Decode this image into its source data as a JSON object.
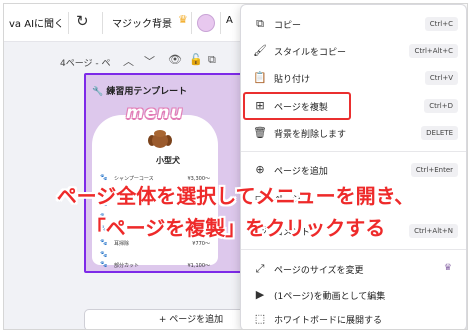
{
  "toolbar": {
    "ask_ai": "va AIに聞く",
    "magic_bg": "マジック背景",
    "text_a": "A",
    "icons": [
      "refresh-icon",
      "crown-icon",
      "color-swatch"
    ]
  },
  "page_header": {
    "label": "4ページ - ペ",
    "icons": [
      "chevron-up-icon",
      "chevron-down-icon",
      "eye-icon",
      "lock-icon",
      "copy-icon"
    ]
  },
  "design": {
    "template_title": "練習用テンプレート",
    "menu_word": "menu",
    "heading": "小型犬",
    "rows": [
      {
        "service": "シャンプーコース",
        "price": "¥3,300〜"
      },
      {
        "service": "",
        "price": ""
      },
      {
        "service": "",
        "price": ""
      },
      {
        "service": "",
        "price": ""
      },
      {
        "service": "",
        "price": ""
      },
      {
        "service": "耳掃除",
        "price": "¥770〜"
      },
      {
        "service": "",
        "price": ""
      },
      {
        "service": "部分カット",
        "price": "¥1,100〜"
      }
    ]
  },
  "add_page": "+ ページを追加",
  "context_menu": {
    "items": [
      {
        "label": "コピー",
        "shortcut": "Ctrl+C",
        "icon": "copy-icon"
      },
      {
        "label": "スタイルをコピー",
        "shortcut": "Ctrl+Alt+C",
        "icon": "paint-roller-icon"
      },
      {
        "label": "貼り付け",
        "shortcut": "Ctrl+V",
        "icon": "clipboard-icon"
      },
      {
        "label": "ページを複製",
        "shortcut": "Ctrl+D",
        "icon": "duplicate-page-icon"
      },
      {
        "label": "背景を削除します",
        "shortcut": "DELETE",
        "icon": "trash-icon"
      },
      {
        "label": "ページを追加",
        "shortcut": "Ctrl+Enter",
        "icon": "add-page-icon"
      },
      {
        "label": "ページ",
        "shortcut": "",
        "icon": "page-icon"
      },
      {
        "label": "コメント",
        "shortcut": "Ctrl+Alt+N",
        "icon": "comment-icon"
      },
      {
        "label": "ページのサイズを変更",
        "shortcut": "",
        "icon": "resize-icon"
      },
      {
        "label": "(1ページ)を動画として編集",
        "shortcut": "",
        "icon": "video-icon"
      },
      {
        "label": "ホワイトボードに展開する",
        "shortcut": "",
        "icon": "whiteboard-icon"
      }
    ]
  },
  "caption": {
    "line1": "ページ全体を選択してメニューを開き、",
    "line2": "「ページを複製」をクリックする"
  },
  "colors": {
    "accent": "#7d2ae8",
    "highlight": "#ea2f2f",
    "caption": "#ee2a2a",
    "page_bg": "#ddc8ec"
  }
}
